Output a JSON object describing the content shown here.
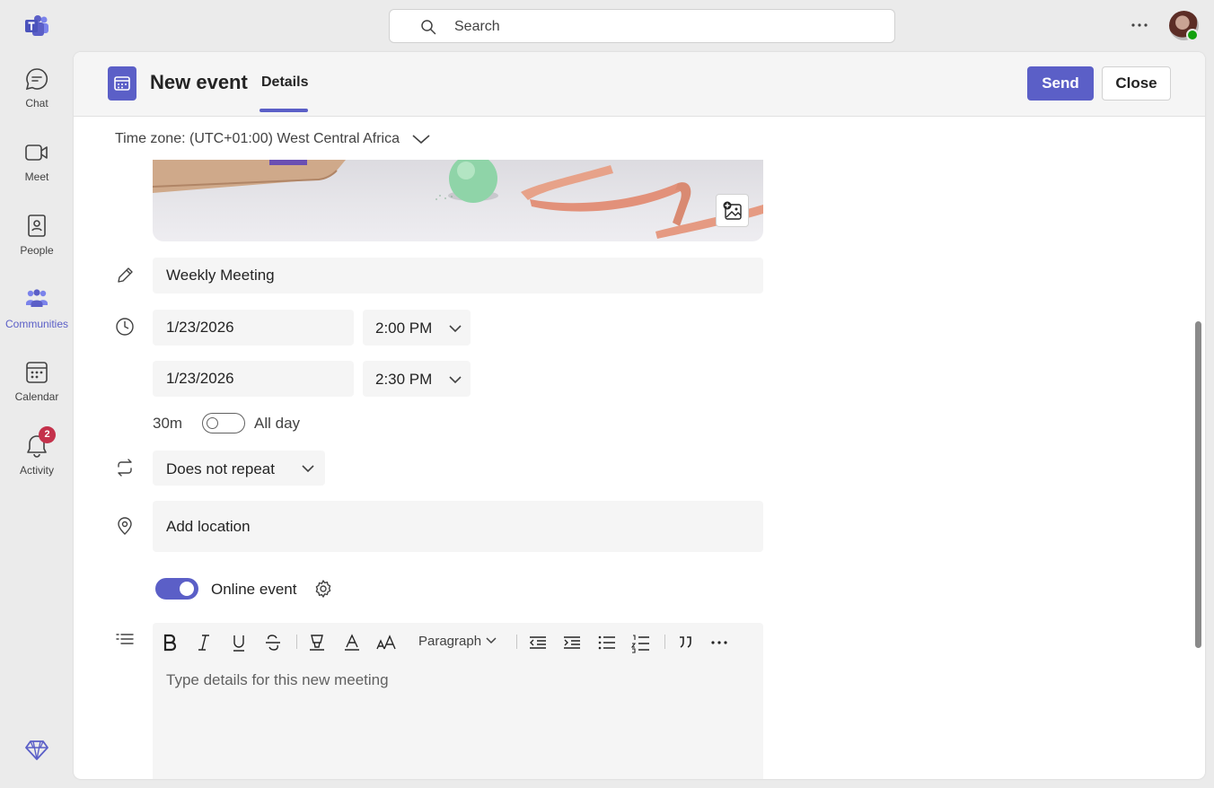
{
  "rail": {
    "items": [
      {
        "label": "Chat"
      },
      {
        "label": "Meet"
      },
      {
        "label": "People"
      },
      {
        "label": "Communities"
      },
      {
        "label": "Calendar"
      },
      {
        "label": "Activity",
        "badge": "2"
      }
    ]
  },
  "topbar": {
    "search_placeholder": "Search"
  },
  "header": {
    "title": "New event",
    "tab": "Details",
    "send_label": "Send",
    "close_label": "Close"
  },
  "form": {
    "timezone": "Time zone: (UTC+01:00) West Central Africa",
    "title_value": "Weekly Meeting",
    "start_date": "1/23/2026",
    "start_time": "2:00 PM",
    "end_date": "1/23/2026",
    "end_time": "2:30 PM",
    "duration": "30m",
    "all_day_label": "All day",
    "all_day": false,
    "repeat": "Does not repeat",
    "location_placeholder": "Add location",
    "online_event_label": "Online event",
    "online_event": true
  },
  "editor": {
    "paragraph_label": "Paragraph",
    "placeholder": "Type details for this new meeting"
  },
  "colors": {
    "accent": "#5b5fc7",
    "badge": "#c4314b",
    "presence": "#13a10e"
  }
}
